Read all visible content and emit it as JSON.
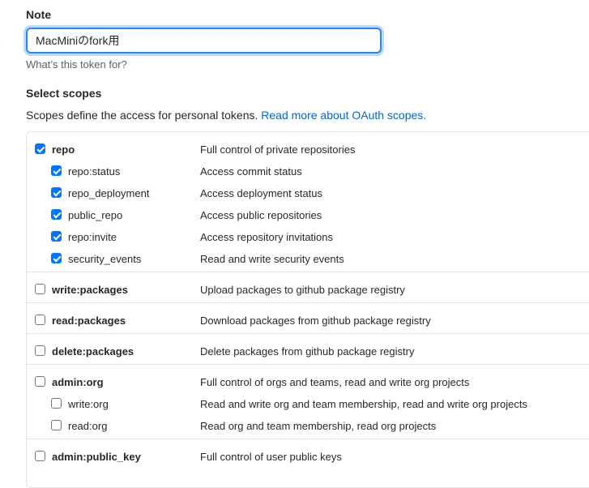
{
  "note": {
    "label": "Note",
    "value": "MacMiniのfork用",
    "hint": "What’s this token for?"
  },
  "scopes": {
    "title": "Select scopes",
    "description": "Scopes define the access for personal tokens. ",
    "link_text": "Read more about OAuth scopes.",
    "items": [
      {
        "name": "repo",
        "desc": "Full control of private repositories",
        "checked": true,
        "level": 1
      },
      {
        "name": "repo:status",
        "desc": "Access commit status",
        "checked": true,
        "level": 2
      },
      {
        "name": "repo_deployment",
        "desc": "Access deployment status",
        "checked": true,
        "level": 2
      },
      {
        "name": "public_repo",
        "desc": "Access public repositories",
        "checked": true,
        "level": 2
      },
      {
        "name": "repo:invite",
        "desc": "Access repository invitations",
        "checked": true,
        "level": 2
      },
      {
        "name": "security_events",
        "desc": "Read and write security events",
        "checked": true,
        "level": 2
      },
      {
        "name": "write:packages",
        "desc": "Upload packages to github package registry",
        "checked": false,
        "level": 1
      },
      {
        "name": "read:packages",
        "desc": "Download packages from github package registry",
        "checked": false,
        "level": 1
      },
      {
        "name": "delete:packages",
        "desc": "Delete packages from github package registry",
        "checked": false,
        "level": 1
      },
      {
        "name": "admin:org",
        "desc": "Full control of orgs and teams, read and write org projects",
        "checked": false,
        "level": 1
      },
      {
        "name": "write:org",
        "desc": "Read and write org and team membership, read and write org projects",
        "checked": false,
        "level": 2
      },
      {
        "name": "read:org",
        "desc": "Read org and team membership, read org projects",
        "checked": false,
        "level": 2
      },
      {
        "name": "admin:public_key",
        "desc": "Full control of user public keys",
        "checked": false,
        "level": 1
      }
    ]
  },
  "colors": {
    "accent": "#0366d6",
    "checkbox": "#0075ff",
    "border": "#e1e4e8"
  }
}
